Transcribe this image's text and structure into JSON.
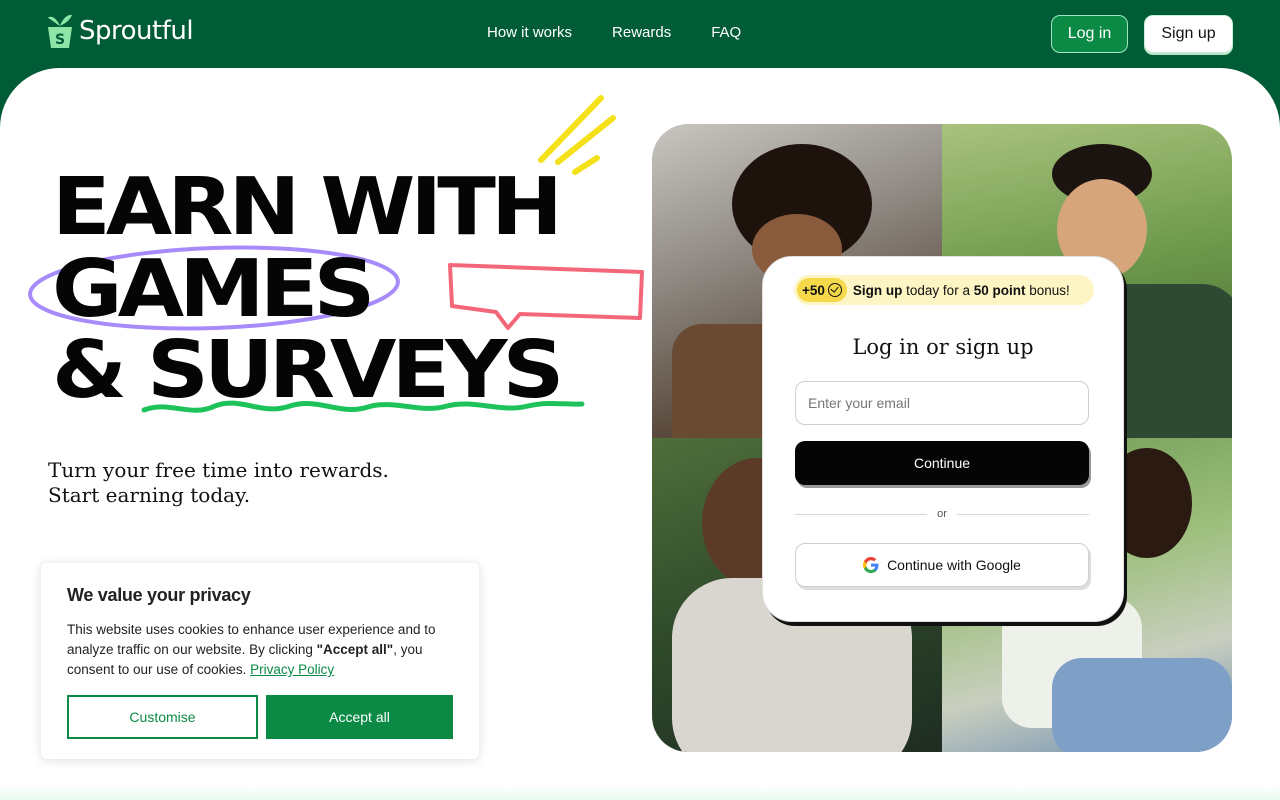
{
  "brand": {
    "name": "Sproutful"
  },
  "nav": {
    "links": [
      "How it works",
      "Rewards",
      "FAQ"
    ]
  },
  "header": {
    "login_label": "Log in",
    "signup_label": "Sign up"
  },
  "hero": {
    "line1": "EARN WITH",
    "line2": "GAMES",
    "line3": "& SURVEYS",
    "sub1": "Turn your free time into rewards.",
    "sub2": "Start earning today."
  },
  "auth_card": {
    "bonus_points": "+50",
    "bonus_signup": "Sign up",
    "bonus_middle": " today for a ",
    "bonus_amount": "50 point",
    "bonus_end": " bonus!",
    "title": "Log in or sign up",
    "email_placeholder": "Enter your email",
    "continue_label": "Continue",
    "divider_label": "or",
    "google_label": "Continue with Google"
  },
  "cookie_banner": {
    "title": "We value your privacy",
    "text_before": "This website uses cookies to enhance user experience and to analyze traffic on our website. By clicking ",
    "text_bold": "\"Accept all\"",
    "text_after": ", you consent to our use of cookies. ",
    "policy_link": "Privacy Policy",
    "customise_label": "Customise",
    "accept_label": "Accept all"
  },
  "colors": {
    "brand_green": "#005c37",
    "accent_green": "#0b8a46",
    "highlight_yellow": "#fdf5c4",
    "scribble_purple": "#a78bfa",
    "scribble_pink": "#f4677a",
    "scribble_green": "#1ec25a",
    "scribble_yellow": "#f5e11a"
  },
  "icons": [
    "sprout-logo-icon",
    "coin-check-icon",
    "google-icon"
  ]
}
